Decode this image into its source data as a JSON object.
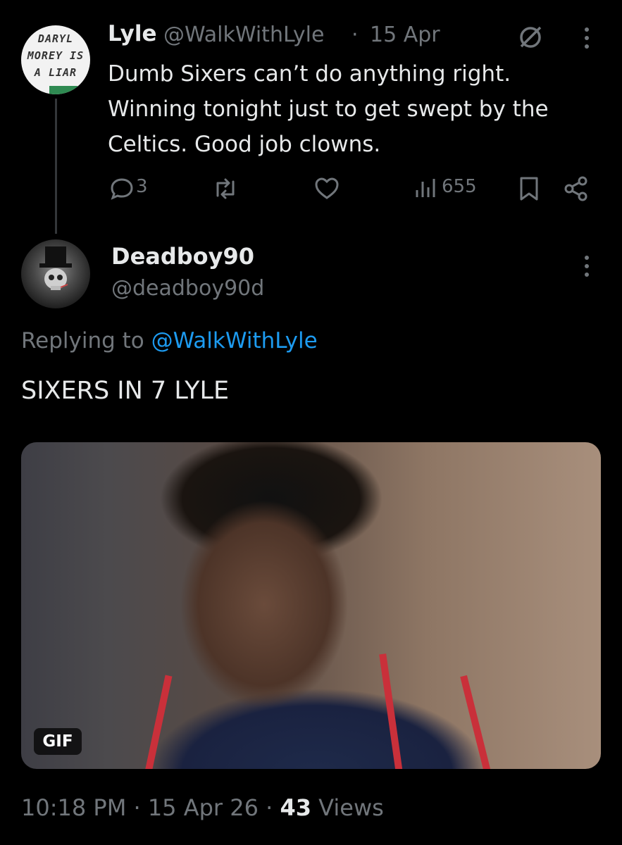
{
  "parent_tweet": {
    "avatar_text": [
      "DARYL",
      "MOREY IS",
      "A LIAR"
    ],
    "name": "Lyle",
    "handle": "@WalkWithLyle",
    "separator": "·",
    "time": "15 Apr",
    "text": "Dumb Sixers can’t do anything right. Winning tonight just to get swept by the Celtics. Good job clowns.",
    "replies": "3",
    "views": "655",
    "icons": [
      "grok-icon",
      "more-icon",
      "reply-icon",
      "retweet-icon",
      "like-icon",
      "views-icon",
      "bookmark-icon",
      "share-icon"
    ]
  },
  "reply_tweet": {
    "name": "Deadboy90",
    "handle": "@deadboy90d",
    "replying_prefix": "Replying to ",
    "replying_handle": "@WalkWithLyle",
    "text": "SIXERS IN 7 LYLE",
    "media_badge": "GIF",
    "time": "10:18 PM",
    "separator": "·",
    "date": "15 Apr 26",
    "views_count": "43",
    "views_label": "Views"
  },
  "colors": {
    "background": "#000000",
    "primary_text": "#e7e9ea",
    "secondary_text": "#71767b",
    "link": "#1d9bf0"
  }
}
